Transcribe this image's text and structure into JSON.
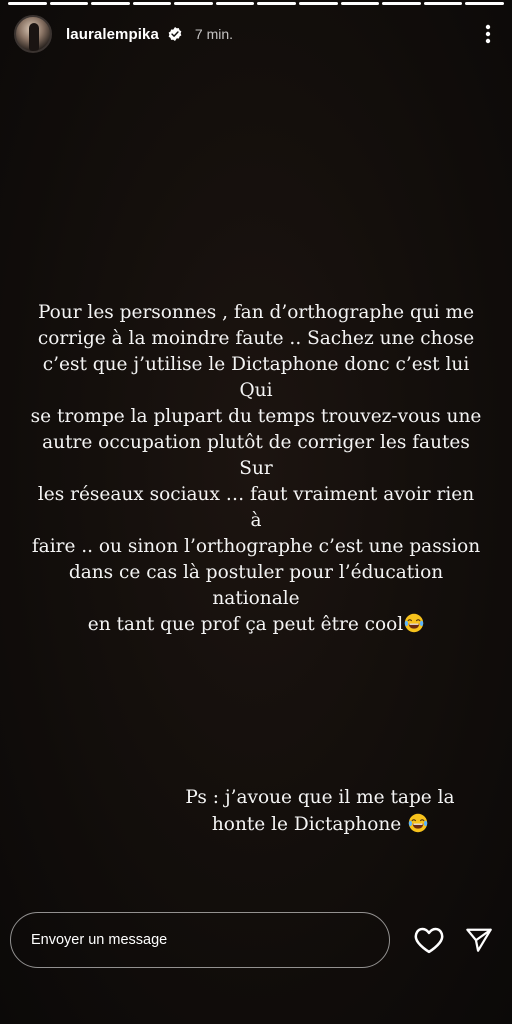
{
  "story": {
    "progress": {
      "segments_total": 12,
      "segments_viewed": 12
    }
  },
  "header": {
    "username": "lauralempika",
    "verified": true,
    "time": "7 min.",
    "icons": {
      "verified": "verified-badge-icon",
      "more": "more-vertical-icon"
    }
  },
  "caption": {
    "main_text": "Pour les personnes , fan d’orthographe qui me\ncorrige  à la moindre faute  .. Sachez une chose\nc’est que j’utilise le Dictaphone donc c’est lui Qui\nse trompe la plupart  du temps trouvez-vous une\nautre occupation plutôt  de corriger les fautes Sur\nles réseaux sociaux  … faut vraiment avoir rien à\nfaire .. ou sinon l’orthographe c’est une passion\ndans ce cas là postuler pour l’éducation nationale\nen tant que prof ça peut être cool",
    "main_emoji": "face-with-tears-of-joy-emoji",
    "ps_text": "Ps : j’avoue que il me tape la\nhonte le Dictaphone ",
    "ps_emoji": "face-with-tears-of-joy-emoji"
  },
  "reply": {
    "placeholder": "Envoyer un message",
    "icons": {
      "like": "heart-icon",
      "send": "send-icon"
    }
  },
  "colors": {
    "background": "#0a0807",
    "text": "#ffffff",
    "emoji_yellow": "#f7c21c"
  }
}
